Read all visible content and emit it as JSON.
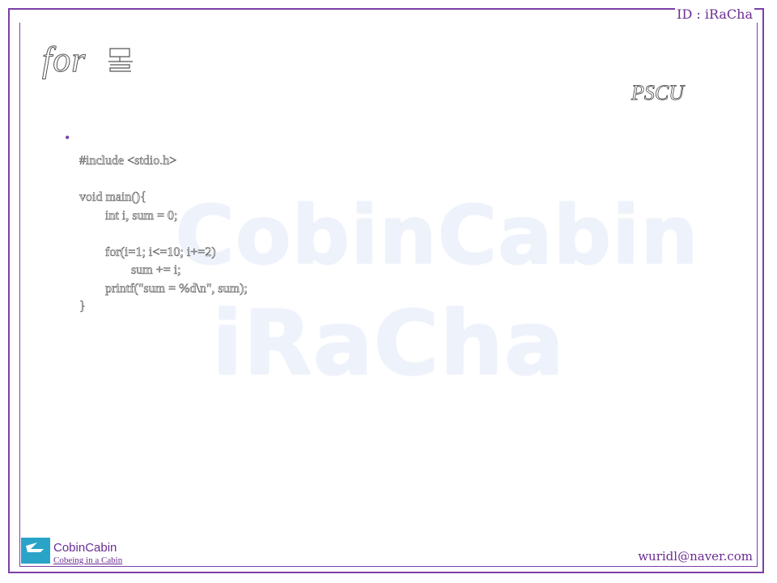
{
  "header": {
    "id_label": "ID : iRaCha"
  },
  "slide": {
    "title": "for",
    "subtitle": "PSCU"
  },
  "watermark": {
    "line1": "CobinCabin",
    "line2": "iRaCha"
  },
  "code_lines": [
    "#include <stdio.h>",
    "",
    "void main(){",
    "        int i, sum = 0;",
    "",
    "        for(i=1; i<=10; i+=2)",
    "                sum += i;",
    "        printf(\"sum = %d\\n\", sum);",
    "}"
  ],
  "footer": {
    "brand": "CobinCabin",
    "tagline": "Cobeing in a Cabin",
    "email": "wuridl@naver.com"
  },
  "colors": {
    "frame": "#7b3fa8",
    "text_accent": "#6a2c91",
    "logo": "#29a3c7"
  }
}
